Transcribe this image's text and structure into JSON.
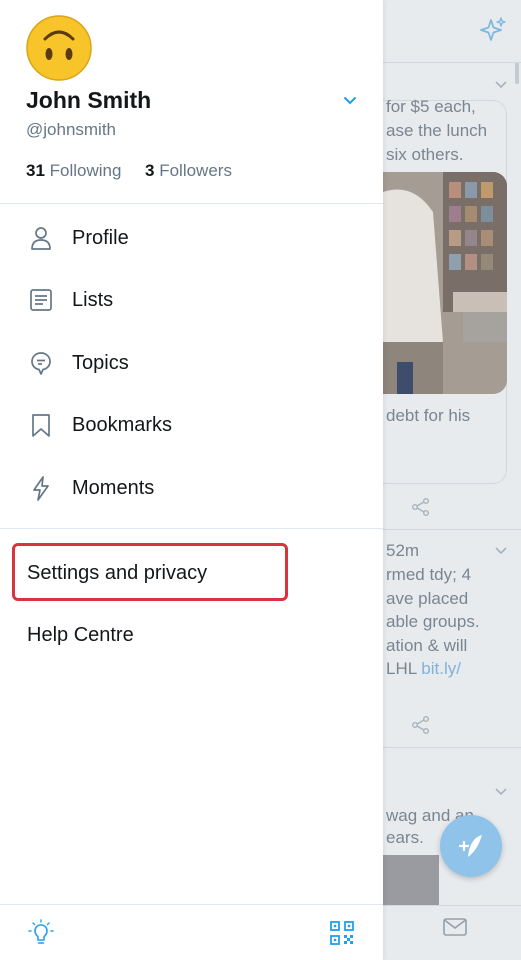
{
  "colors": {
    "accent": "#1da1f2",
    "highlight": "#d7343d",
    "text_primary": "#14171a",
    "text_secondary": "#657786"
  },
  "drawer": {
    "avatar_icon": "upside-down-face-emoji",
    "name": "John Smith",
    "handle": "@johnsmith",
    "following_count": "31",
    "following_label": "Following",
    "followers_count": "3",
    "followers_label": "Followers",
    "menu": [
      {
        "label": "Profile",
        "icon": "person-icon"
      },
      {
        "label": "Lists",
        "icon": "list-icon"
      },
      {
        "label": "Topics",
        "icon": "topic-bubble-icon"
      },
      {
        "label": "Bookmarks",
        "icon": "bookmark-icon"
      },
      {
        "label": "Moments",
        "icon": "lightning-icon"
      }
    ],
    "settings_label": "Settings and privacy",
    "help_label": "Help Centre",
    "footer": {
      "left_icon": "lightbulb-icon",
      "right_icon": "qr-code-icon"
    }
  },
  "feed": {
    "tweet1_lines": [
      "for $5 each,",
      "ase the lunch",
      "six others."
    ],
    "tweet1_tail": "debt for his",
    "tweet2_time": "52m",
    "tweet2_lines": [
      "rmed tdy; 4",
      "ave placed",
      "able groups.",
      "ation & will"
    ],
    "tweet2_last_prefix": "LHL ",
    "tweet2_link": "bit.ly/",
    "tweet3_lines": [
      "wag and an",
      "ears."
    ]
  }
}
